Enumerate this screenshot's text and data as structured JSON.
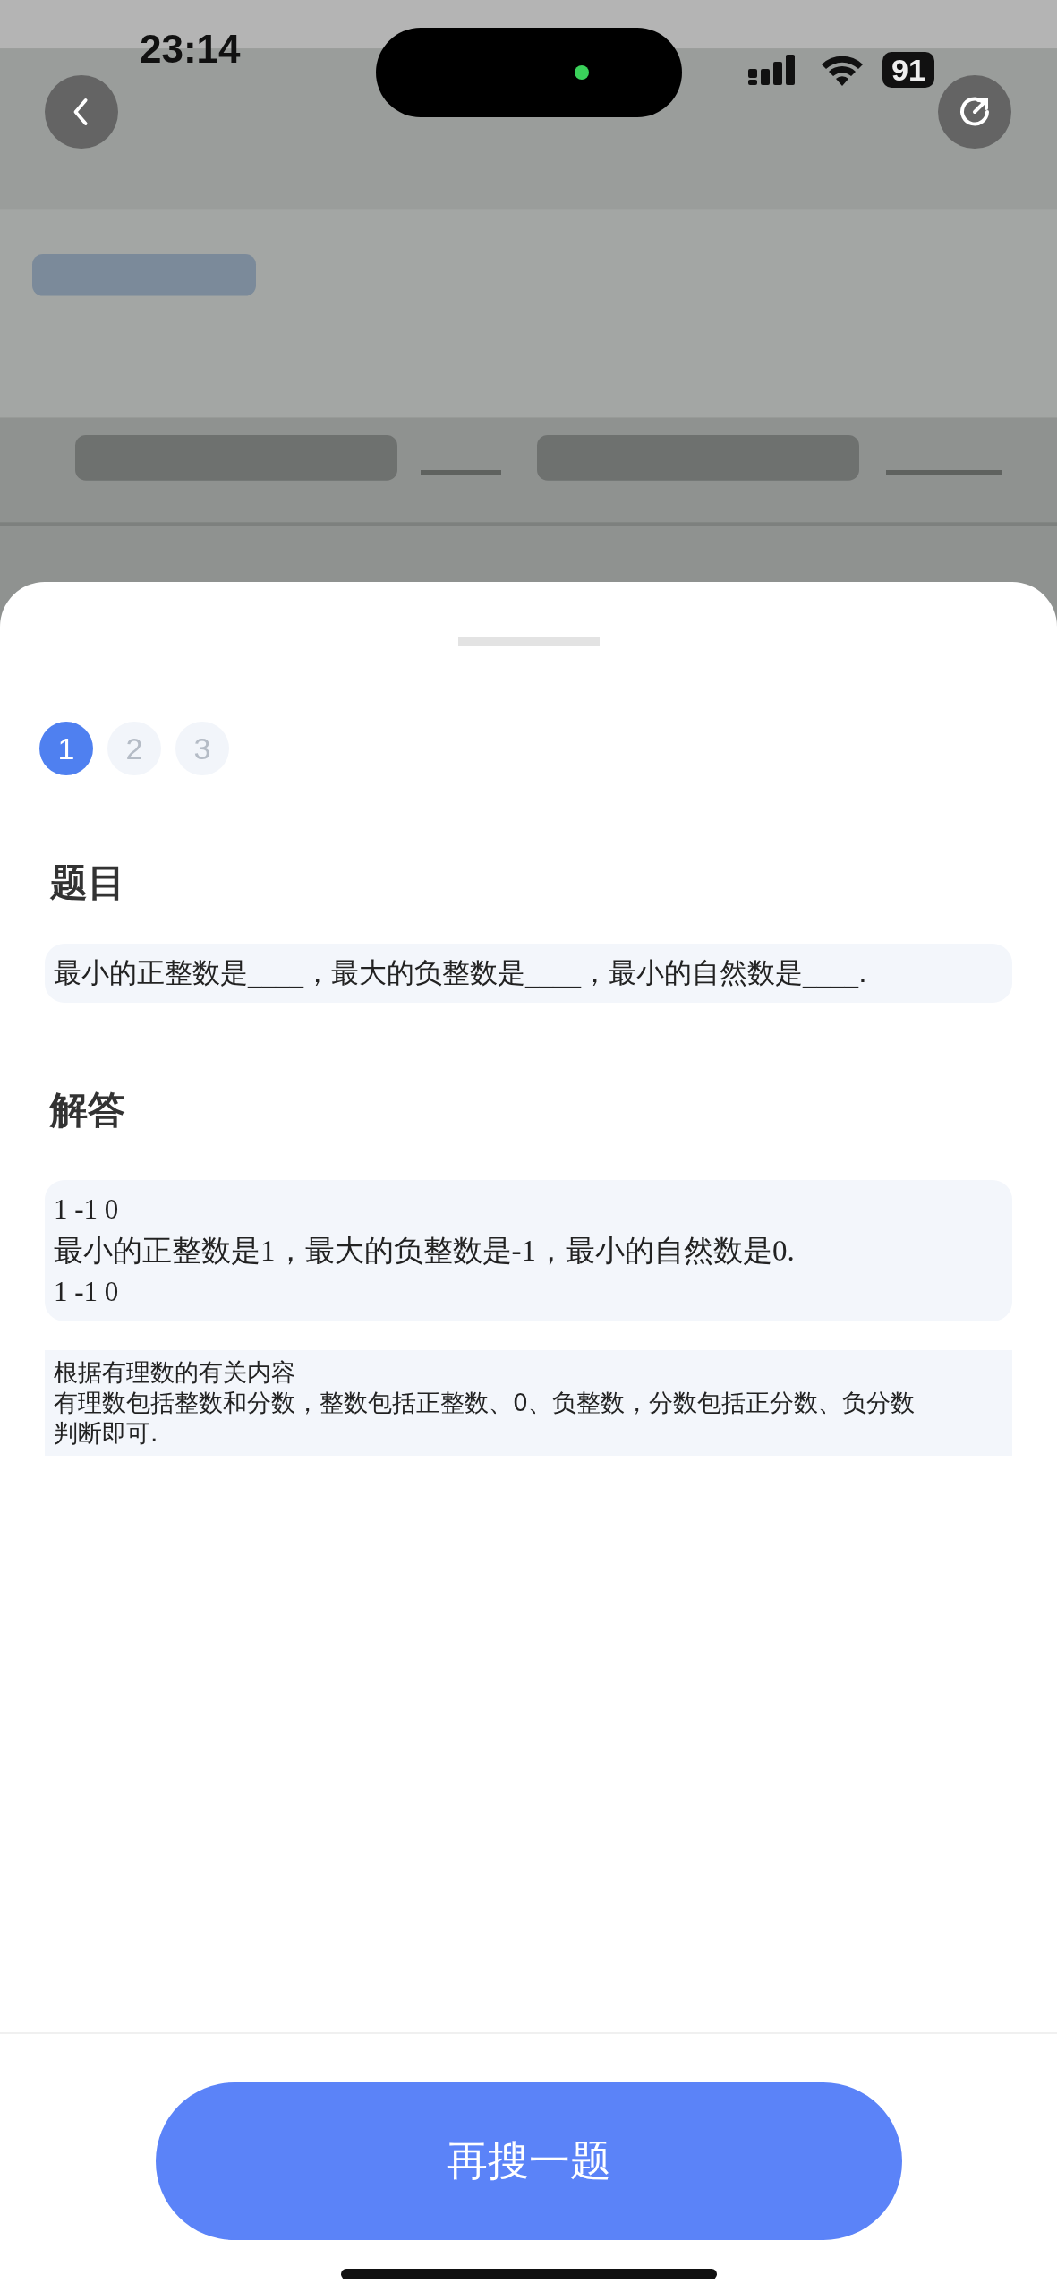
{
  "status_bar": {
    "time": "23:14",
    "battery": "91"
  },
  "steps": [
    {
      "label": "1",
      "selected": true
    },
    {
      "label": "2",
      "selected": false
    },
    {
      "label": "3",
      "selected": false
    }
  ],
  "sections": [
    {
      "heading": "题目",
      "blocks": [
        {
          "kind": "question",
          "lines": [
            "最小的正整数是____，最大的负整数是____，最小的自然数是____."
          ]
        }
      ]
    },
    {
      "heading": "解答",
      "blocks": [
        {
          "kind": "answer",
          "lines": [
            "1 -1 0",
            "最小的正整数是1，最大的负整数是-1，最小的自然数是0.",
            "1 -1 0"
          ]
        },
        {
          "kind": "analysis",
          "lines": [
            "根据有理数的有关内容",
            "有理数包括整数和分数，整数包括正整数、0、负整数，分数包括正分数、负分数",
            "判断即可."
          ]
        }
      ]
    }
  ],
  "button": "再搜一题"
}
